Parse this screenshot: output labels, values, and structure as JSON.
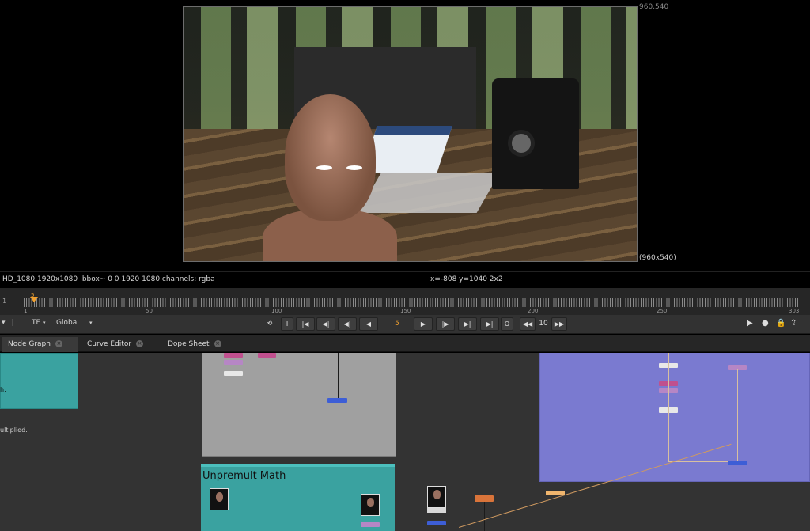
{
  "viewer": {
    "format_top_right": "960,540",
    "format_bottom_right": "(960x540)"
  },
  "info_bar": {
    "left": "HD_1080 1920x1080  bbox~ 0 0 1920 1080 channels: rgba",
    "coords": "x=-808 y=1040 2x2"
  },
  "timeline": {
    "start_frame": "1",
    "current_frame_marker": "5",
    "tick_labels": [
      "1",
      "50",
      "100",
      "150",
      "200",
      "250",
      "303"
    ]
  },
  "transport": {
    "tf_label": "TF",
    "scope_label": "Global",
    "current_frame": "5",
    "increment": "10",
    "buttons": {
      "loop": "⟲",
      "in_point": "I",
      "to_start": "|◀",
      "prev_key": "◀|",
      "prev_frame": "◀|",
      "play_back": "◀",
      "play_fwd": "▶",
      "next_frame": "|▶",
      "next_key": "▶|",
      "to_end": "▶|",
      "out_point": "O",
      "skip_back": "◀◀",
      "skip_fwd": "▶▶"
    }
  },
  "tabs": [
    {
      "label": "Node Graph",
      "active": true
    },
    {
      "label": "Curve Editor",
      "active": false
    },
    {
      "label": "Dope Sheet",
      "active": false
    }
  ],
  "graph": {
    "teal_left_note": "h.",
    "left_note": "ultiplied.",
    "backdrop_title": "Unpremult Math"
  },
  "colors": {
    "playhead": "#f0a030",
    "teal_backdrop": "#3aa2a0",
    "purple_backdrop": "#7a7ad0",
    "grey_backdrop": "#a0a0a0"
  }
}
